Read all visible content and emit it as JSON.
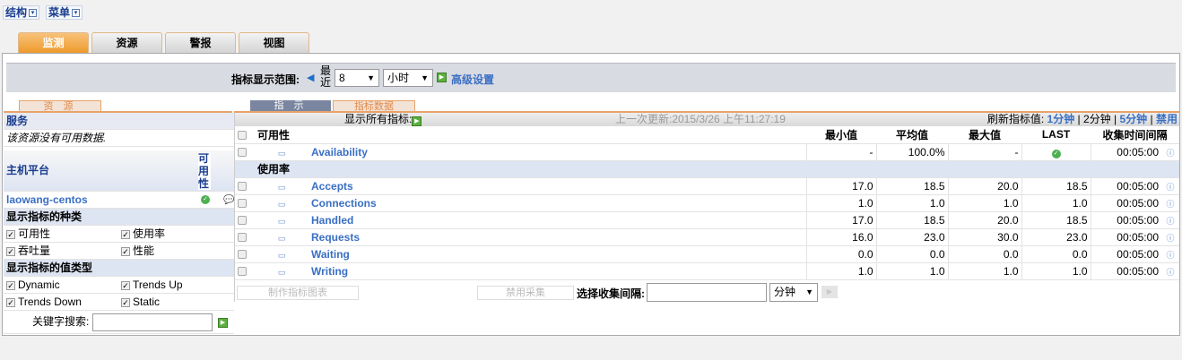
{
  "topbar": {
    "structure": "结构",
    "menu": "菜单"
  },
  "tabs": [
    "监测",
    "资源",
    "警报",
    "视图"
  ],
  "filter": {
    "label": "指标显示范围:",
    "recent": "最近",
    "count": "8",
    "unit": "小时",
    "advanced": "高级设置"
  },
  "subtabs": {
    "resource": "资 源",
    "indicator": "指 示",
    "metric_data": "指标数据"
  },
  "left": {
    "services_title": "服务",
    "no_data": "该资源没有可用数据.",
    "platform_title": "主机平台",
    "availability_col": "可用性",
    "host": "laowang-centos",
    "categories_title": "显示指标的种类",
    "categories": [
      "可用性",
      "使用率",
      "吞吐量",
      "性能"
    ],
    "value_types_title": "显示指标的值类型",
    "value_types": [
      "Dynamic",
      "Trends Up",
      "Trends Down",
      "Static"
    ],
    "keyword_label": "关键字搜索:",
    "keyword_value": ""
  },
  "metrics": {
    "show_all": "显示所有指标:",
    "last_update": "上一次更新:2015/3/26 上午11:27:19",
    "refresh_label": "刷新指标值:",
    "refresh_options": [
      "1分钟",
      "2分钟",
      "5分钟",
      "禁用"
    ],
    "headers": {
      "min": "最小值",
      "avg": "平均值",
      "max": "最大值",
      "last": "LAST",
      "interval": "收集时间间隔"
    },
    "group1": "可用性",
    "availability": {
      "name": "Availability",
      "min": "-",
      "avg": "100.0%",
      "max": "-",
      "interval": "00:05:00"
    },
    "group2": "使用率",
    "rows": [
      {
        "name": "Accepts",
        "min": "17.0",
        "avg": "18.5",
        "max": "20.0",
        "last": "18.5",
        "interval": "00:05:00"
      },
      {
        "name": "Connections",
        "min": "1.0",
        "avg": "1.0",
        "max": "1.0",
        "last": "1.0",
        "interval": "00:05:00"
      },
      {
        "name": "Handled",
        "min": "17.0",
        "avg": "18.5",
        "max": "20.0",
        "last": "18.5",
        "interval": "00:05:00"
      },
      {
        "name": "Requests",
        "min": "16.0",
        "avg": "23.0",
        "max": "30.0",
        "last": "23.0",
        "interval": "00:05:00"
      },
      {
        "name": "Waiting",
        "min": "0.0",
        "avg": "0.0",
        "max": "0.0",
        "last": "0.0",
        "interval": "00:05:00"
      },
      {
        "name": "Writing",
        "min": "1.0",
        "avg": "1.0",
        "max": "1.0",
        "last": "1.0",
        "interval": "00:05:00"
      }
    ],
    "make_chart": "制作指标图表",
    "disable_collect": "禁用采集",
    "select_interval": "选择收集间隔:",
    "interval_value": "",
    "interval_unit": "分钟"
  }
}
